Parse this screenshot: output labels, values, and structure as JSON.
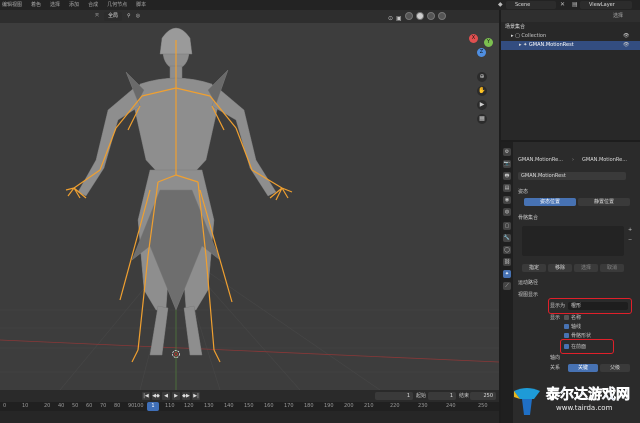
{
  "topbar": {
    "menus": [
      "编辑视图",
      "着色",
      "选择",
      "添加",
      "合成",
      "几何节点",
      "脚本"
    ],
    "scene": "Scene",
    "view_layer": "ViewLayer"
  },
  "viewport": {
    "orientation": "全局",
    "gizmo_axes": [
      "X",
      "Y",
      "Z"
    ]
  },
  "timeline": {
    "current_frame": "1",
    "start_label": "起始",
    "start": "1",
    "end_label": "结束",
    "end": "250",
    "ticks": [
      "0",
      "10",
      "20",
      "40",
      "50",
      "60",
      "70",
      "80",
      "90",
      "100",
      "110",
      "120",
      "130",
      "140",
      "150",
      "160",
      "170",
      "180",
      "190",
      "200",
      "210",
      "220",
      "230",
      "240",
      "250"
    ],
    "cursor_frame": "1"
  },
  "outliner": {
    "title": "场景集合",
    "collection": "Collection",
    "armature": "GMAN.MotionRest",
    "search_placeholder": "选择"
  },
  "properties": {
    "breadcrumb_obj": "GMAN.MotionRe...",
    "breadcrumb_data": "GMAN.MotionRe...",
    "data_name": "GMAN.MotionRest",
    "section_pose": "姿态",
    "pose_position": "姿态位置",
    "rest_position": "静置位置",
    "section_bone_collections": "骨骼集合",
    "assign": "指定",
    "remove": "移除",
    "select": "选择",
    "deselect": "取消",
    "section_motion_paths": "运动路径",
    "section_viewport_display": "视图显示",
    "display_as_label": "显示为",
    "display_as_value": "棍形",
    "show_label": "显示",
    "opt_names": "名称",
    "opt_axes": "轴线",
    "opt_shapes": "骨骼形状",
    "opt_in_front": "在前面",
    "axes_label": "轴向",
    "relation_label": "关系",
    "relation_rest": "关键",
    "relation_shape": "父级"
  },
  "watermark": {
    "title": "泰尔达游戏网",
    "url": "www.tairda.com"
  },
  "colors": {
    "bone": "#f0a030",
    "accent": "#4772b3",
    "highlight_box": "#e0202a"
  }
}
